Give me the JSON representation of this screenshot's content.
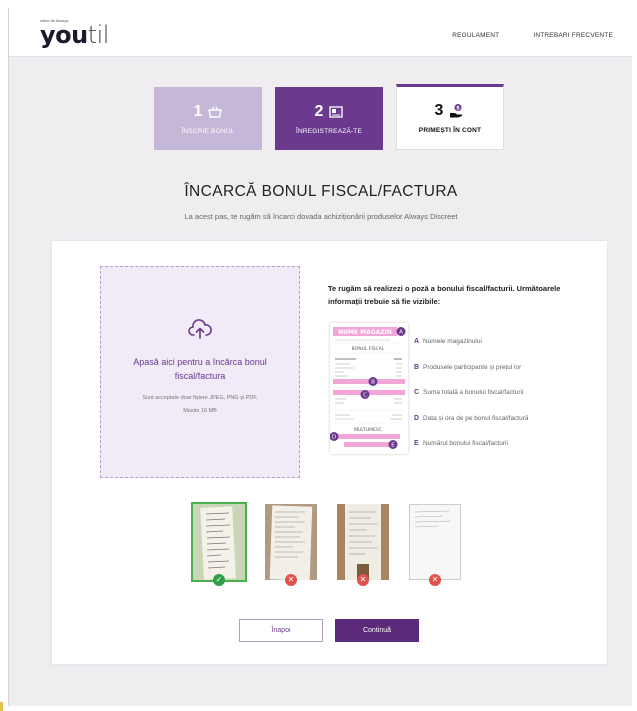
{
  "header": {
    "logo_small": "client de Always",
    "logo_bold": "you",
    "logo_light": "til",
    "nav": [
      "REGULAMENT",
      "INTREBARI FRECVENTE"
    ]
  },
  "steps": [
    {
      "number": "1",
      "label": "ÎNSCRIE BONUL",
      "icon": "basket-icon"
    },
    {
      "number": "2",
      "label": "ÎNREGISTREAZĂ-TE",
      "icon": "profile-card-icon"
    },
    {
      "number": "3",
      "label": "PRIMEȘTI ÎN CONT",
      "icon": "money-hand-icon"
    }
  ],
  "page": {
    "title": "ÎNCARCĂ BONUL FISCAL/FACTURA",
    "subtitle": "La acest pas, te rugăm să încarci dovada achiziționării produselor Always Discreet"
  },
  "dropzone": {
    "title": "Apasă aici pentru a încărca bonul fiscal/factura",
    "note": "Sunt acceptate doar fișiere JPEG, PNG și PDF.",
    "max": "Maxim 16 MB"
  },
  "instructions": {
    "text": "Te rugăm să realizezi o poză a bonului fiscal/facturii. Următoarele informații trebuie să fie vizibile:",
    "receipt_store": "NUME MAGAZIN",
    "receipt_title": "BONUL FISCAL",
    "receipt_thanks": "MULTUMESC",
    "items": [
      {
        "letter": "A",
        "text": "Numele magazinului"
      },
      {
        "letter": "B",
        "text": "Produsele participante și prețul lor"
      },
      {
        "letter": "C",
        "text": "Suma totală a bonului fiscal/facturii"
      },
      {
        "letter": "D",
        "text": "Data și ora de pe bonul fiscal/factură"
      },
      {
        "letter": "E",
        "text": "Numărul bonului fiscal/facturii"
      }
    ]
  },
  "thumbnails": [
    {
      "status": "valid"
    },
    {
      "status": "invalid"
    },
    {
      "status": "invalid"
    },
    {
      "status": "invalid"
    }
  ],
  "buttons": {
    "back": "Înapoi",
    "continue": "Continuă"
  },
  "colors": {
    "primary": "#5b2a7a",
    "accent_light": "#c5b7d7",
    "receipt_pink": "#f2a6d8",
    "ok": "#2e9e4a",
    "error": "#e0524d"
  }
}
